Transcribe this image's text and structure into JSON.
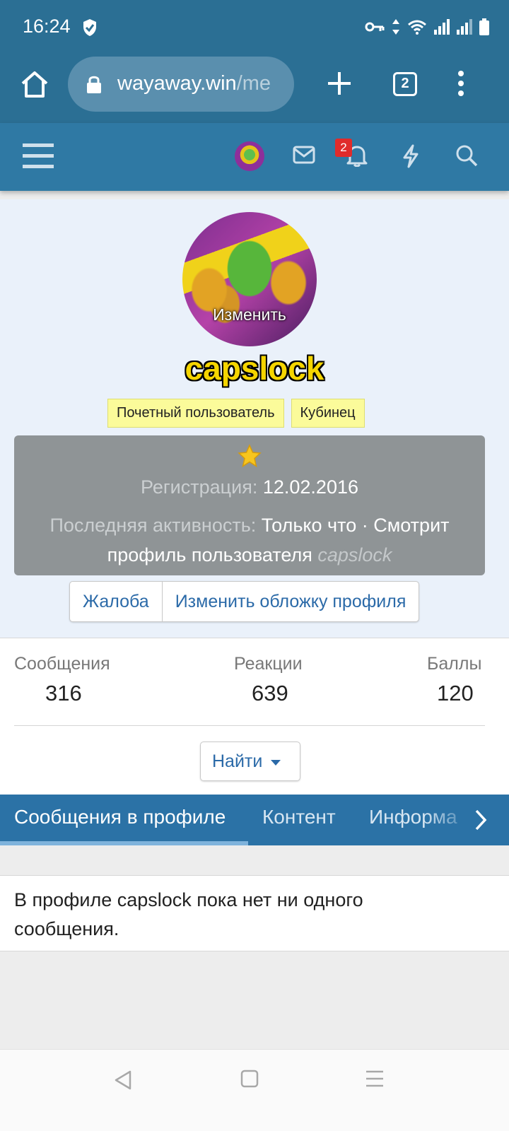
{
  "status_bar": {
    "time": "16:24"
  },
  "browser": {
    "url_main": "wayaway.win",
    "url_rest": "/me",
    "tab_count": "2"
  },
  "nav": {
    "notification_count": "2"
  },
  "profile": {
    "avatar_edit": "Изменить",
    "username": "capslock",
    "badges": [
      "Почетный пользователь",
      "Кубинец"
    ],
    "registration_label": "Регистрация:",
    "registration_date": "12.02.2016",
    "activity_label": "Последняя активность:",
    "activity_value": "Только что · Смотрит профиль пользователя",
    "activity_user": "capslock",
    "report_button": "Жалоба",
    "cover_button": "Изменить обложку профиля"
  },
  "stats": {
    "messages_label": "Сообщения",
    "messages_value": "316",
    "reactions_label": "Реакции",
    "reactions_value": "639",
    "points_label": "Баллы",
    "points_value": "120",
    "find_button": "Найти"
  },
  "tabs": [
    "Сообщения в профиле",
    "Контент",
    "Информа"
  ],
  "empty_message": "В профиле capslock пока нет ни одного сообщения.",
  "colors": {
    "header": "#2b6f94",
    "nav": "#2f79a4",
    "tabs": "#2b72a6",
    "link": "#2b6aa8",
    "username": "#f5d500",
    "badge_bg": "#fbfb9a"
  }
}
